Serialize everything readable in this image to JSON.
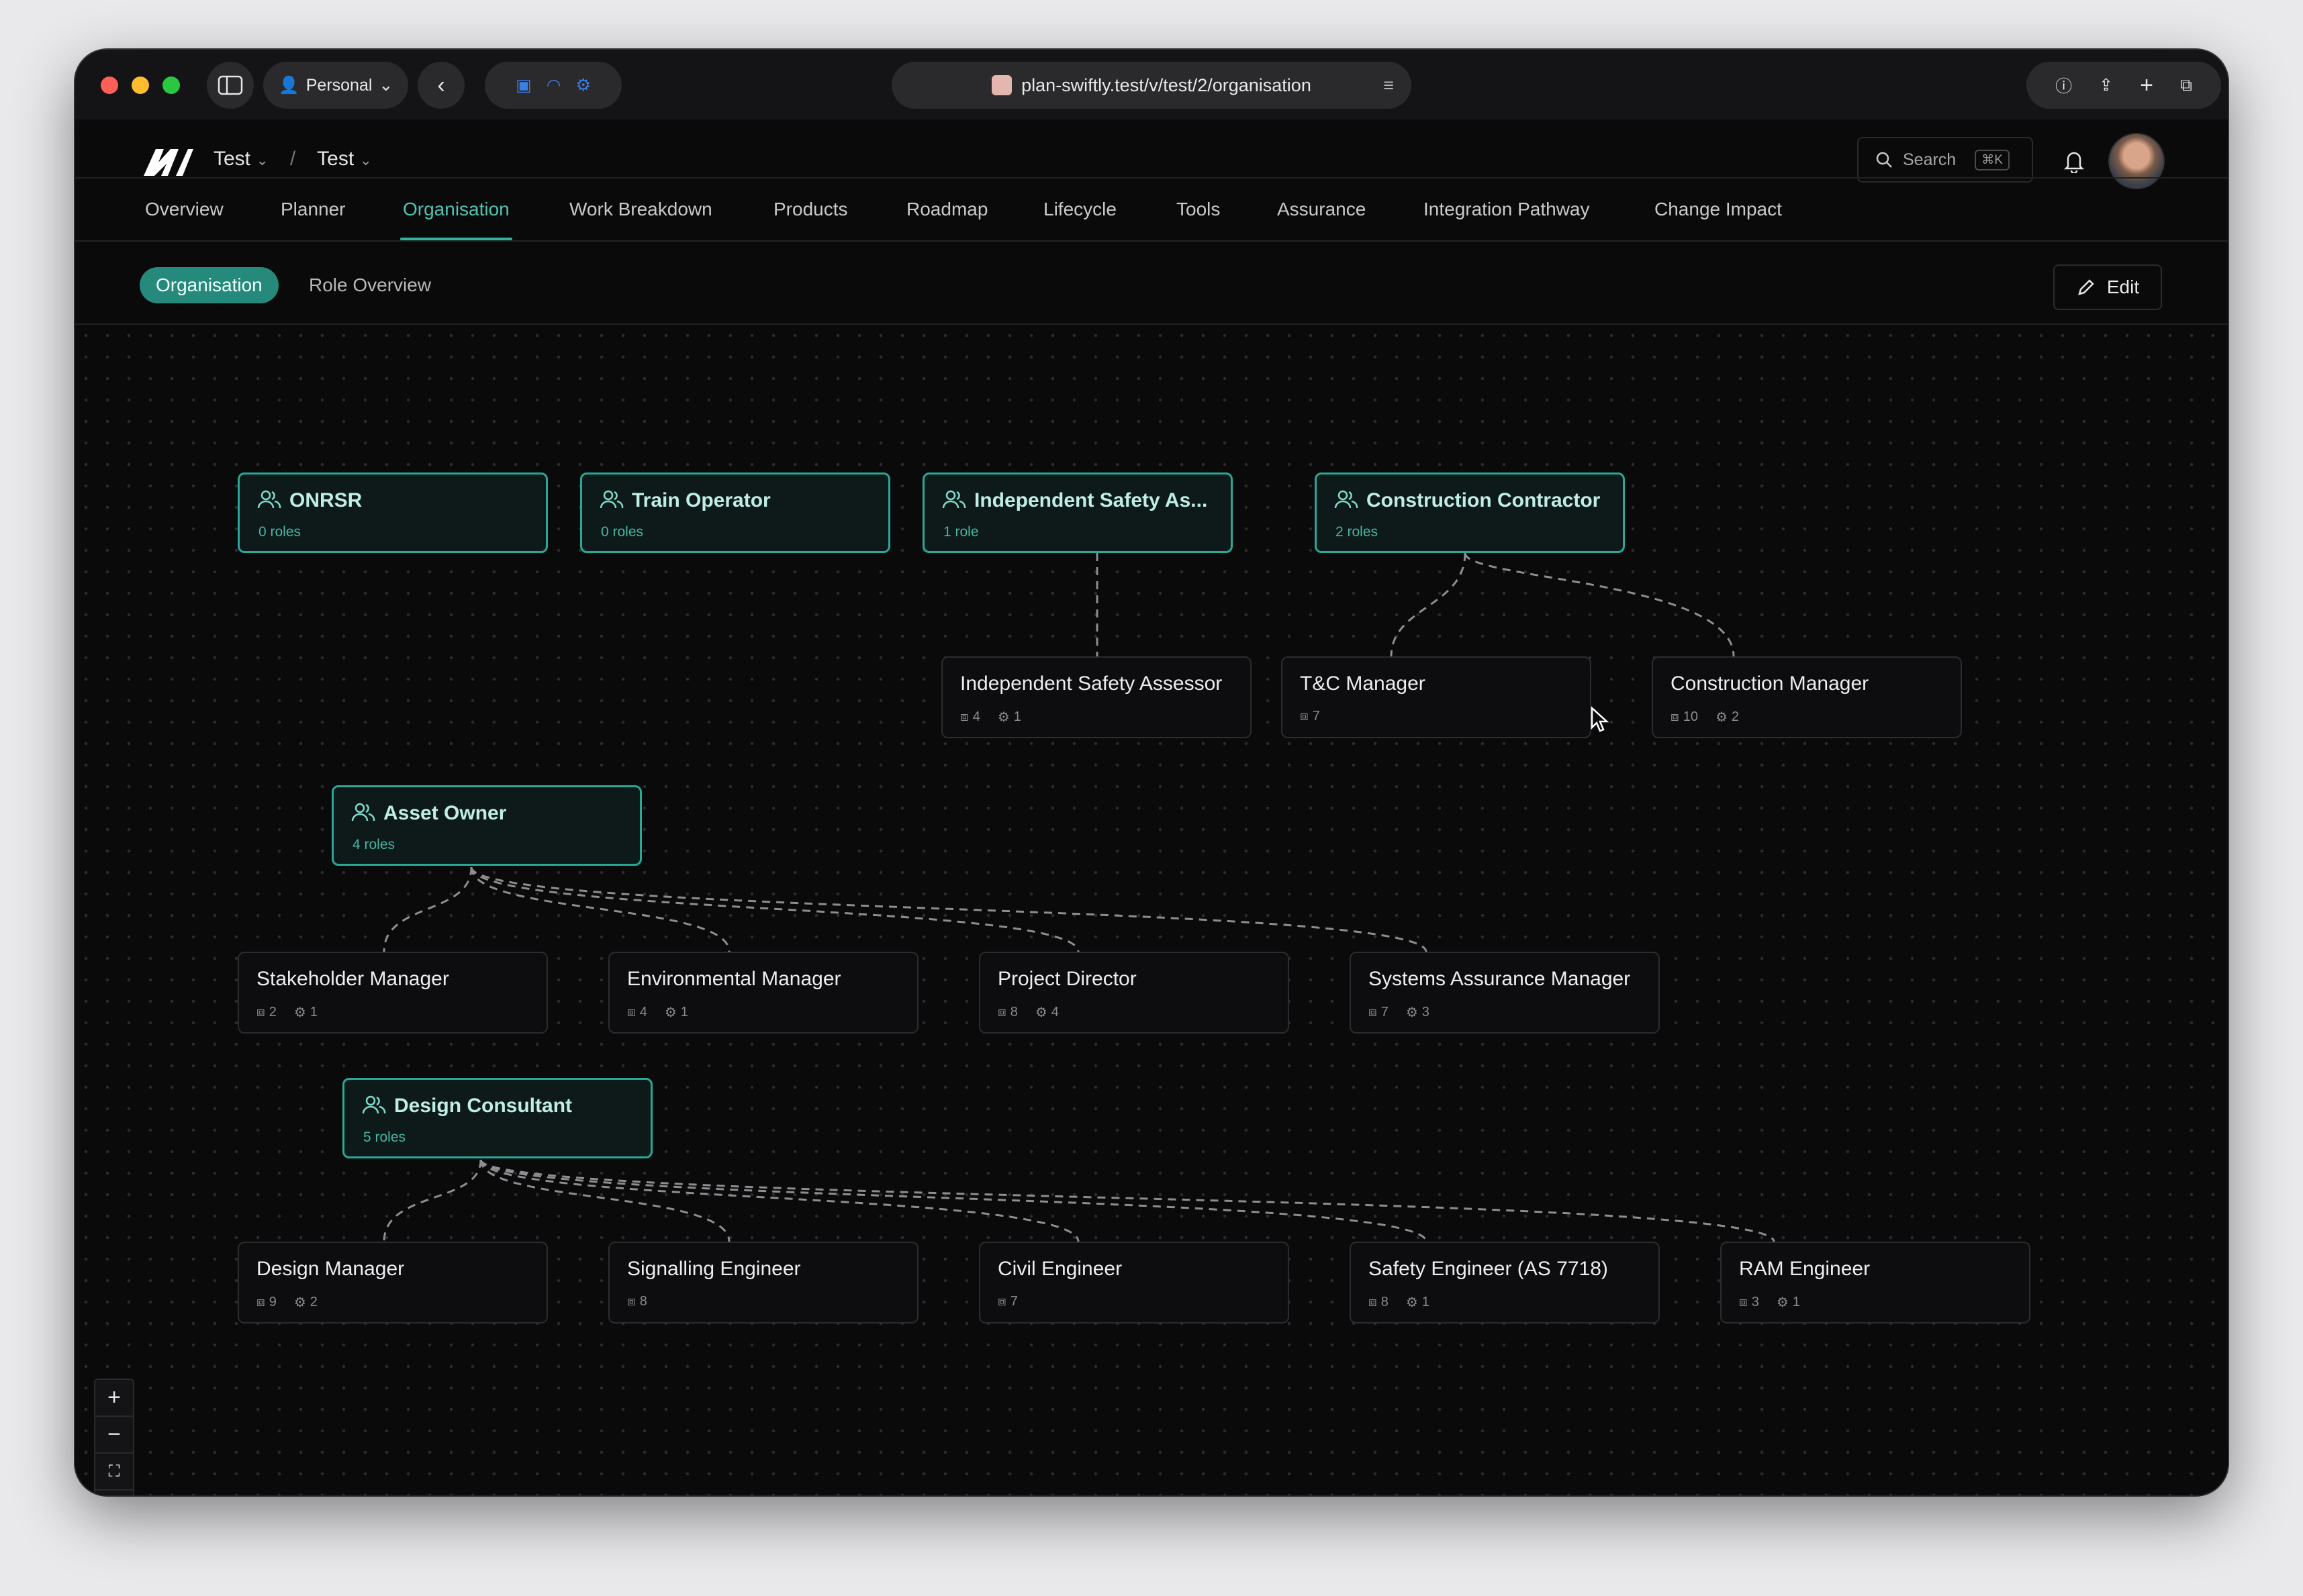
{
  "browser": {
    "profile": "Personal",
    "url": "plan-swiftly.test/v/test/2/organisation"
  },
  "header": {
    "breadcrumb": [
      "Test",
      "Test"
    ],
    "breadcrumb_sep": "/",
    "search_label": "Search",
    "search_shortcut": "⌘K"
  },
  "nav": {
    "tabs": [
      "Overview",
      "Planner",
      "Organisation",
      "Work Breakdown",
      "Products",
      "Roadmap",
      "Lifecycle",
      "Tools",
      "Assurance",
      "Integration Pathway",
      "Change Impact"
    ],
    "active": "Organisation"
  },
  "subnav": {
    "tabs": [
      "Organisation",
      "Role Overview"
    ],
    "edit_label": "Edit"
  },
  "organisations": [
    {
      "name": "ONRSR",
      "count": "0 roles"
    },
    {
      "name": "Train Operator",
      "count": "0 roles"
    },
    {
      "name": "Independent Safety As...",
      "count": "1 role"
    },
    {
      "name": "Construction Contractor",
      "count": "2 roles"
    },
    {
      "name": "Asset Owner",
      "count": "4 roles"
    },
    {
      "name": "Design Consultant",
      "count": "5 roles"
    }
  ],
  "roles": [
    {
      "name": "Independent Safety Assessor",
      "a": "4",
      "b": "1"
    },
    {
      "name": "T&C Manager",
      "a": "7",
      "b": ""
    },
    {
      "name": "Construction Manager",
      "a": "10",
      "b": "2"
    },
    {
      "name": "Stakeholder Manager",
      "a": "2",
      "b": "1"
    },
    {
      "name": "Environmental Manager",
      "a": "4",
      "b": "1"
    },
    {
      "name": "Project Director",
      "a": "8",
      "b": "4"
    },
    {
      "name": "Systems Assurance Manager",
      "a": "7",
      "b": "3"
    },
    {
      "name": "Design Manager",
      "a": "9",
      "b": "2"
    },
    {
      "name": "Signalling Engineer",
      "a": "8",
      "b": ""
    },
    {
      "name": "Civil Engineer",
      "a": "7",
      "b": ""
    },
    {
      "name": "Safety Engineer (AS 7718)",
      "a": "8",
      "b": "1"
    },
    {
      "name": "RAM Engineer",
      "a": "3",
      "b": "1"
    }
  ],
  "colors": {
    "accent": "#2bb6a1",
    "background": "#0a0a0b"
  }
}
